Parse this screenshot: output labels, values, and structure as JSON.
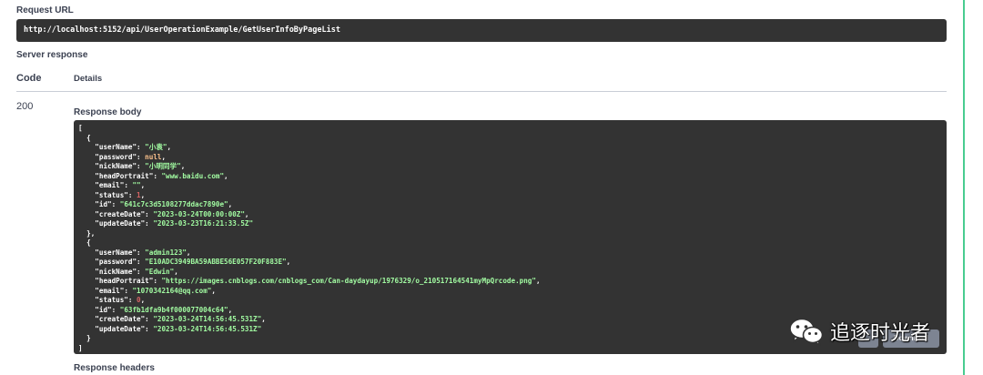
{
  "request_url": {
    "label": "Request URL",
    "value": "http://localhost:5152/api/UserOperationExample/GetUserInfoByPageList"
  },
  "server_response": {
    "label": "Server response",
    "columns": {
      "code": "Code",
      "details": "Details"
    },
    "status_code": "200",
    "response_body_label": "Response body",
    "response_headers_label": "Response headers",
    "download_label": "Download"
  },
  "body_lines": [
    [
      [
        "p",
        "["
      ]
    ],
    [
      [
        "p",
        "  {"
      ]
    ],
    [
      [
        "p",
        "    "
      ],
      [
        "k",
        "\"userName\""
      ],
      [
        "p",
        ": "
      ],
      [
        "s",
        "\"小袁\""
      ],
      [
        "p",
        ","
      ]
    ],
    [
      [
        "p",
        "    "
      ],
      [
        "k",
        "\"password\""
      ],
      [
        "p",
        ": "
      ],
      [
        "nul",
        "null"
      ],
      [
        "p",
        ","
      ]
    ],
    [
      [
        "p",
        "    "
      ],
      [
        "k",
        "\"nickName\""
      ],
      [
        "p",
        ": "
      ],
      [
        "s",
        "\"小明同学\""
      ],
      [
        "p",
        ","
      ]
    ],
    [
      [
        "p",
        "    "
      ],
      [
        "k",
        "\"headPortrait\""
      ],
      [
        "p",
        ": "
      ],
      [
        "s",
        "\"www.baidu.com\""
      ],
      [
        "p",
        ","
      ]
    ],
    [
      [
        "p",
        "    "
      ],
      [
        "k",
        "\"email\""
      ],
      [
        "p",
        ": "
      ],
      [
        "s",
        "\"\""
      ],
      [
        "p",
        ","
      ]
    ],
    [
      [
        "p",
        "    "
      ],
      [
        "k",
        "\"status\""
      ],
      [
        "p",
        ": "
      ],
      [
        "n",
        "1"
      ],
      [
        "p",
        ","
      ]
    ],
    [
      [
        "p",
        "    "
      ],
      [
        "k",
        "\"id\""
      ],
      [
        "p",
        ": "
      ],
      [
        "s",
        "\"641c7c3d5108277ddac7890e\""
      ],
      [
        "p",
        ","
      ]
    ],
    [
      [
        "p",
        "    "
      ],
      [
        "k",
        "\"createDate\""
      ],
      [
        "p",
        ": "
      ],
      [
        "s",
        "\"2023-03-24T00:00:00Z\""
      ],
      [
        "p",
        ","
      ]
    ],
    [
      [
        "p",
        "    "
      ],
      [
        "k",
        "\"updateDate\""
      ],
      [
        "p",
        ": "
      ],
      [
        "s",
        "\"2023-03-23T16:21:33.5Z\""
      ]
    ],
    [
      [
        "p",
        "  },"
      ]
    ],
    [
      [
        "p",
        "  {"
      ]
    ],
    [
      [
        "p",
        "    "
      ],
      [
        "k",
        "\"userName\""
      ],
      [
        "p",
        ": "
      ],
      [
        "s",
        "\"admin123\""
      ],
      [
        "p",
        ","
      ]
    ],
    [
      [
        "p",
        "    "
      ],
      [
        "k",
        "\"password\""
      ],
      [
        "p",
        ": "
      ],
      [
        "s",
        "\"E10ADC3949BA59ABBE56E057F20F883E\""
      ],
      [
        "p",
        ","
      ]
    ],
    [
      [
        "p",
        "    "
      ],
      [
        "k",
        "\"nickName\""
      ],
      [
        "p",
        ": "
      ],
      [
        "s",
        "\"Edwin\""
      ],
      [
        "p",
        ","
      ]
    ],
    [
      [
        "p",
        "    "
      ],
      [
        "k",
        "\"headPortrait\""
      ],
      [
        "p",
        ": "
      ],
      [
        "s",
        "\"https://images.cnblogs.com/cnblogs_com/Can-daydayup/1976329/o_210517164541myMpQrcode.png\""
      ],
      [
        "p",
        ","
      ]
    ],
    [
      [
        "p",
        "    "
      ],
      [
        "k",
        "\"email\""
      ],
      [
        "p",
        ": "
      ],
      [
        "s",
        "\"1070342164@qq.com\""
      ],
      [
        "p",
        ","
      ]
    ],
    [
      [
        "p",
        "    "
      ],
      [
        "k",
        "\"status\""
      ],
      [
        "p",
        ": "
      ],
      [
        "n",
        "0"
      ],
      [
        "p",
        ","
      ]
    ],
    [
      [
        "p",
        "    "
      ],
      [
        "k",
        "\"id\""
      ],
      [
        "p",
        ": "
      ],
      [
        "s",
        "\"63fb1dfa9b4f000077004c64\""
      ],
      [
        "p",
        ","
      ]
    ],
    [
      [
        "p",
        "    "
      ],
      [
        "k",
        "\"createDate\""
      ],
      [
        "p",
        ": "
      ],
      [
        "s",
        "\"2023-03-24T14:56:45.531Z\""
      ],
      [
        "p",
        ","
      ]
    ],
    [
      [
        "p",
        "    "
      ],
      [
        "k",
        "\"updateDate\""
      ],
      [
        "p",
        ": "
      ],
      [
        "s",
        "\"2023-03-24T14:56:45.531Z\""
      ]
    ],
    [
      [
        "p",
        "  }"
      ]
    ],
    [
      [
        "p",
        "]"
      ]
    ]
  ],
  "watermark": {
    "text": "追逐时光者",
    "icon": "wechat-icon"
  },
  "colors": {
    "accent_border": "#49cc90",
    "code_bg": "#333333",
    "string": "#a2fca2",
    "number": "#d36363",
    "null": "#fcc28c"
  }
}
